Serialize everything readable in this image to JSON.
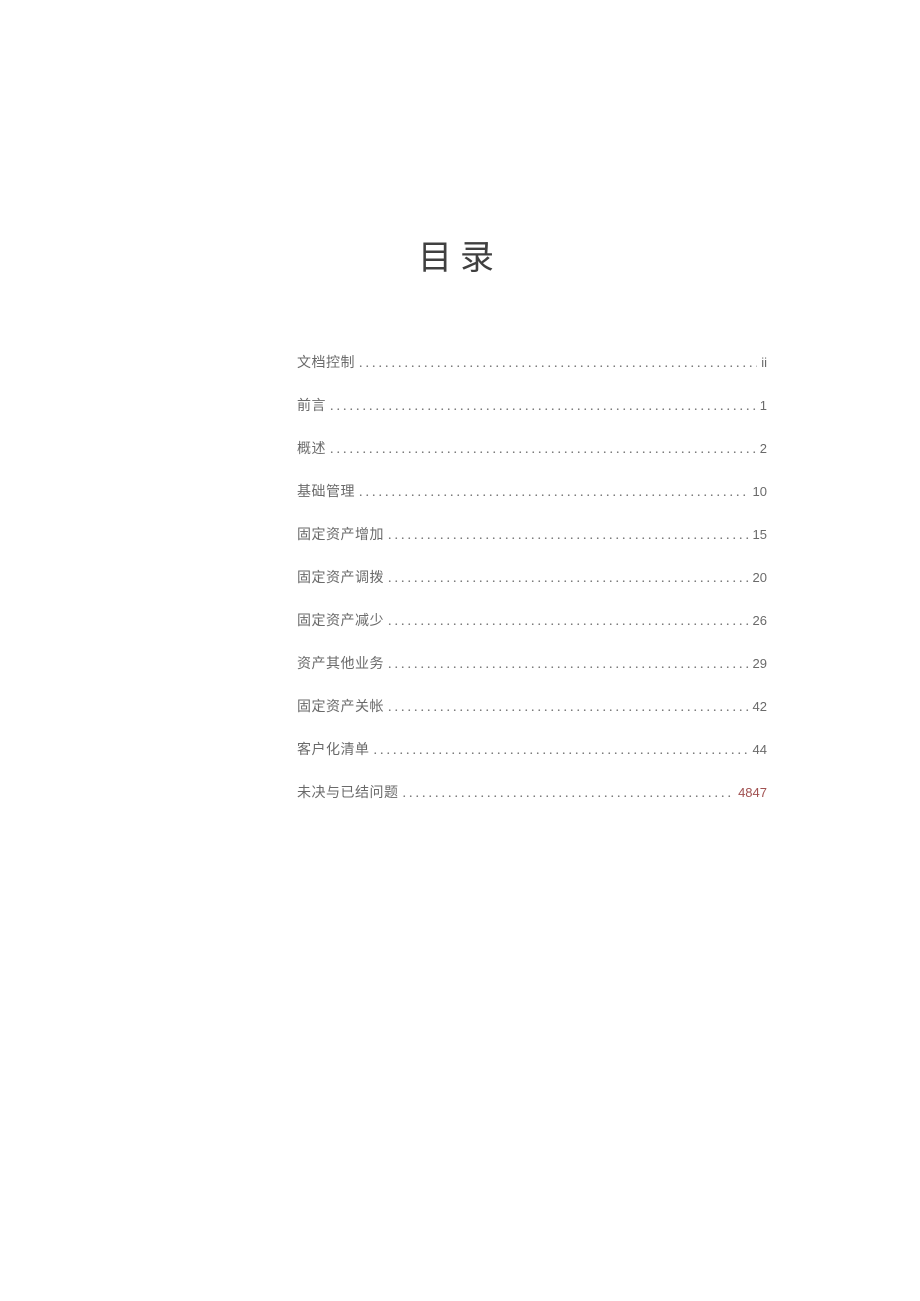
{
  "title": "目录",
  "toc": {
    "items": [
      {
        "label": "文档控制",
        "page": "ii",
        "page_alt": ""
      },
      {
        "label": "前言",
        "page": "1",
        "page_alt": ""
      },
      {
        "label": "概述",
        "page": "2",
        "page_alt": ""
      },
      {
        "label": "基础管理",
        "page": "10",
        "page_alt": ""
      },
      {
        "label": "固定资产增加",
        "page": "15",
        "page_alt": ""
      },
      {
        "label": "固定资产调拨",
        "page": "20",
        "page_alt": ""
      },
      {
        "label": "固定资产减少",
        "page": "26",
        "page_alt": ""
      },
      {
        "label": "资产其他业务",
        "page": "29",
        "page_alt": ""
      },
      {
        "label": "固定资产关帐",
        "page": "42",
        "page_alt": ""
      },
      {
        "label": "客户化清单",
        "page": "44",
        "page_alt": ""
      },
      {
        "label": "未决与已结问题",
        "page": "",
        "page_alt": "4847"
      }
    ]
  }
}
